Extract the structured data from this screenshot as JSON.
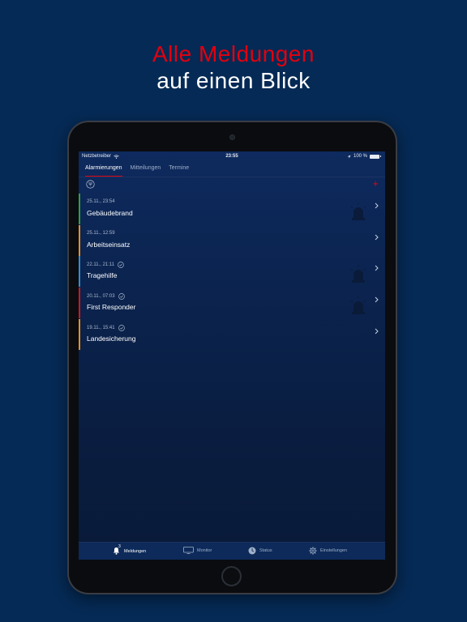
{
  "headline": {
    "line1": "Alle Meldungen",
    "line2": "auf einen Blick",
    "line1_color": "#e3000f",
    "line2_color": "#ffffff"
  },
  "status_bar": {
    "carrier": "Netzbetreiber",
    "time": "23:55",
    "battery": "100 %"
  },
  "tabs": [
    {
      "label": "Alarmierungen",
      "active": true
    },
    {
      "label": "Mitteilungen",
      "active": false
    },
    {
      "label": "Termine",
      "active": false
    }
  ],
  "toolbar": {
    "filter_icon": "filter-icon",
    "add_label": "+"
  },
  "alerts": [
    {
      "datetime": "25.11., 23:54",
      "title": "Gebäudebrand",
      "color": "#2ea043",
      "acknowledged": false,
      "siren": true
    },
    {
      "datetime": "25.11., 12:59",
      "title": "Arbeitseinsatz",
      "color": "#f0901e",
      "acknowledged": false,
      "siren": false
    },
    {
      "datetime": "22.11., 21:11",
      "title": "Tragehilfe",
      "color": "#2f8fd6",
      "acknowledged": true,
      "siren": true
    },
    {
      "datetime": "20.11., 07:03",
      "title": "First Responder",
      "color": "#d5141f",
      "acknowledged": true,
      "siren": true
    },
    {
      "datetime": "19.11., 15:41",
      "title": "Landesicherung",
      "color": "#f0901e",
      "acknowledged": true,
      "siren": false
    }
  ],
  "bottom_nav": [
    {
      "label": "Meldungen",
      "icon": "bell-icon",
      "badge": "3",
      "active": true
    },
    {
      "label": "Monitor",
      "icon": "monitor-icon",
      "active": false
    },
    {
      "label": "Status",
      "icon": "clock-icon",
      "active": false
    },
    {
      "label": "Einstellungen",
      "icon": "gear-icon",
      "active": false
    }
  ],
  "colors": {
    "background": "#052a55",
    "accent": "#e3000f"
  }
}
